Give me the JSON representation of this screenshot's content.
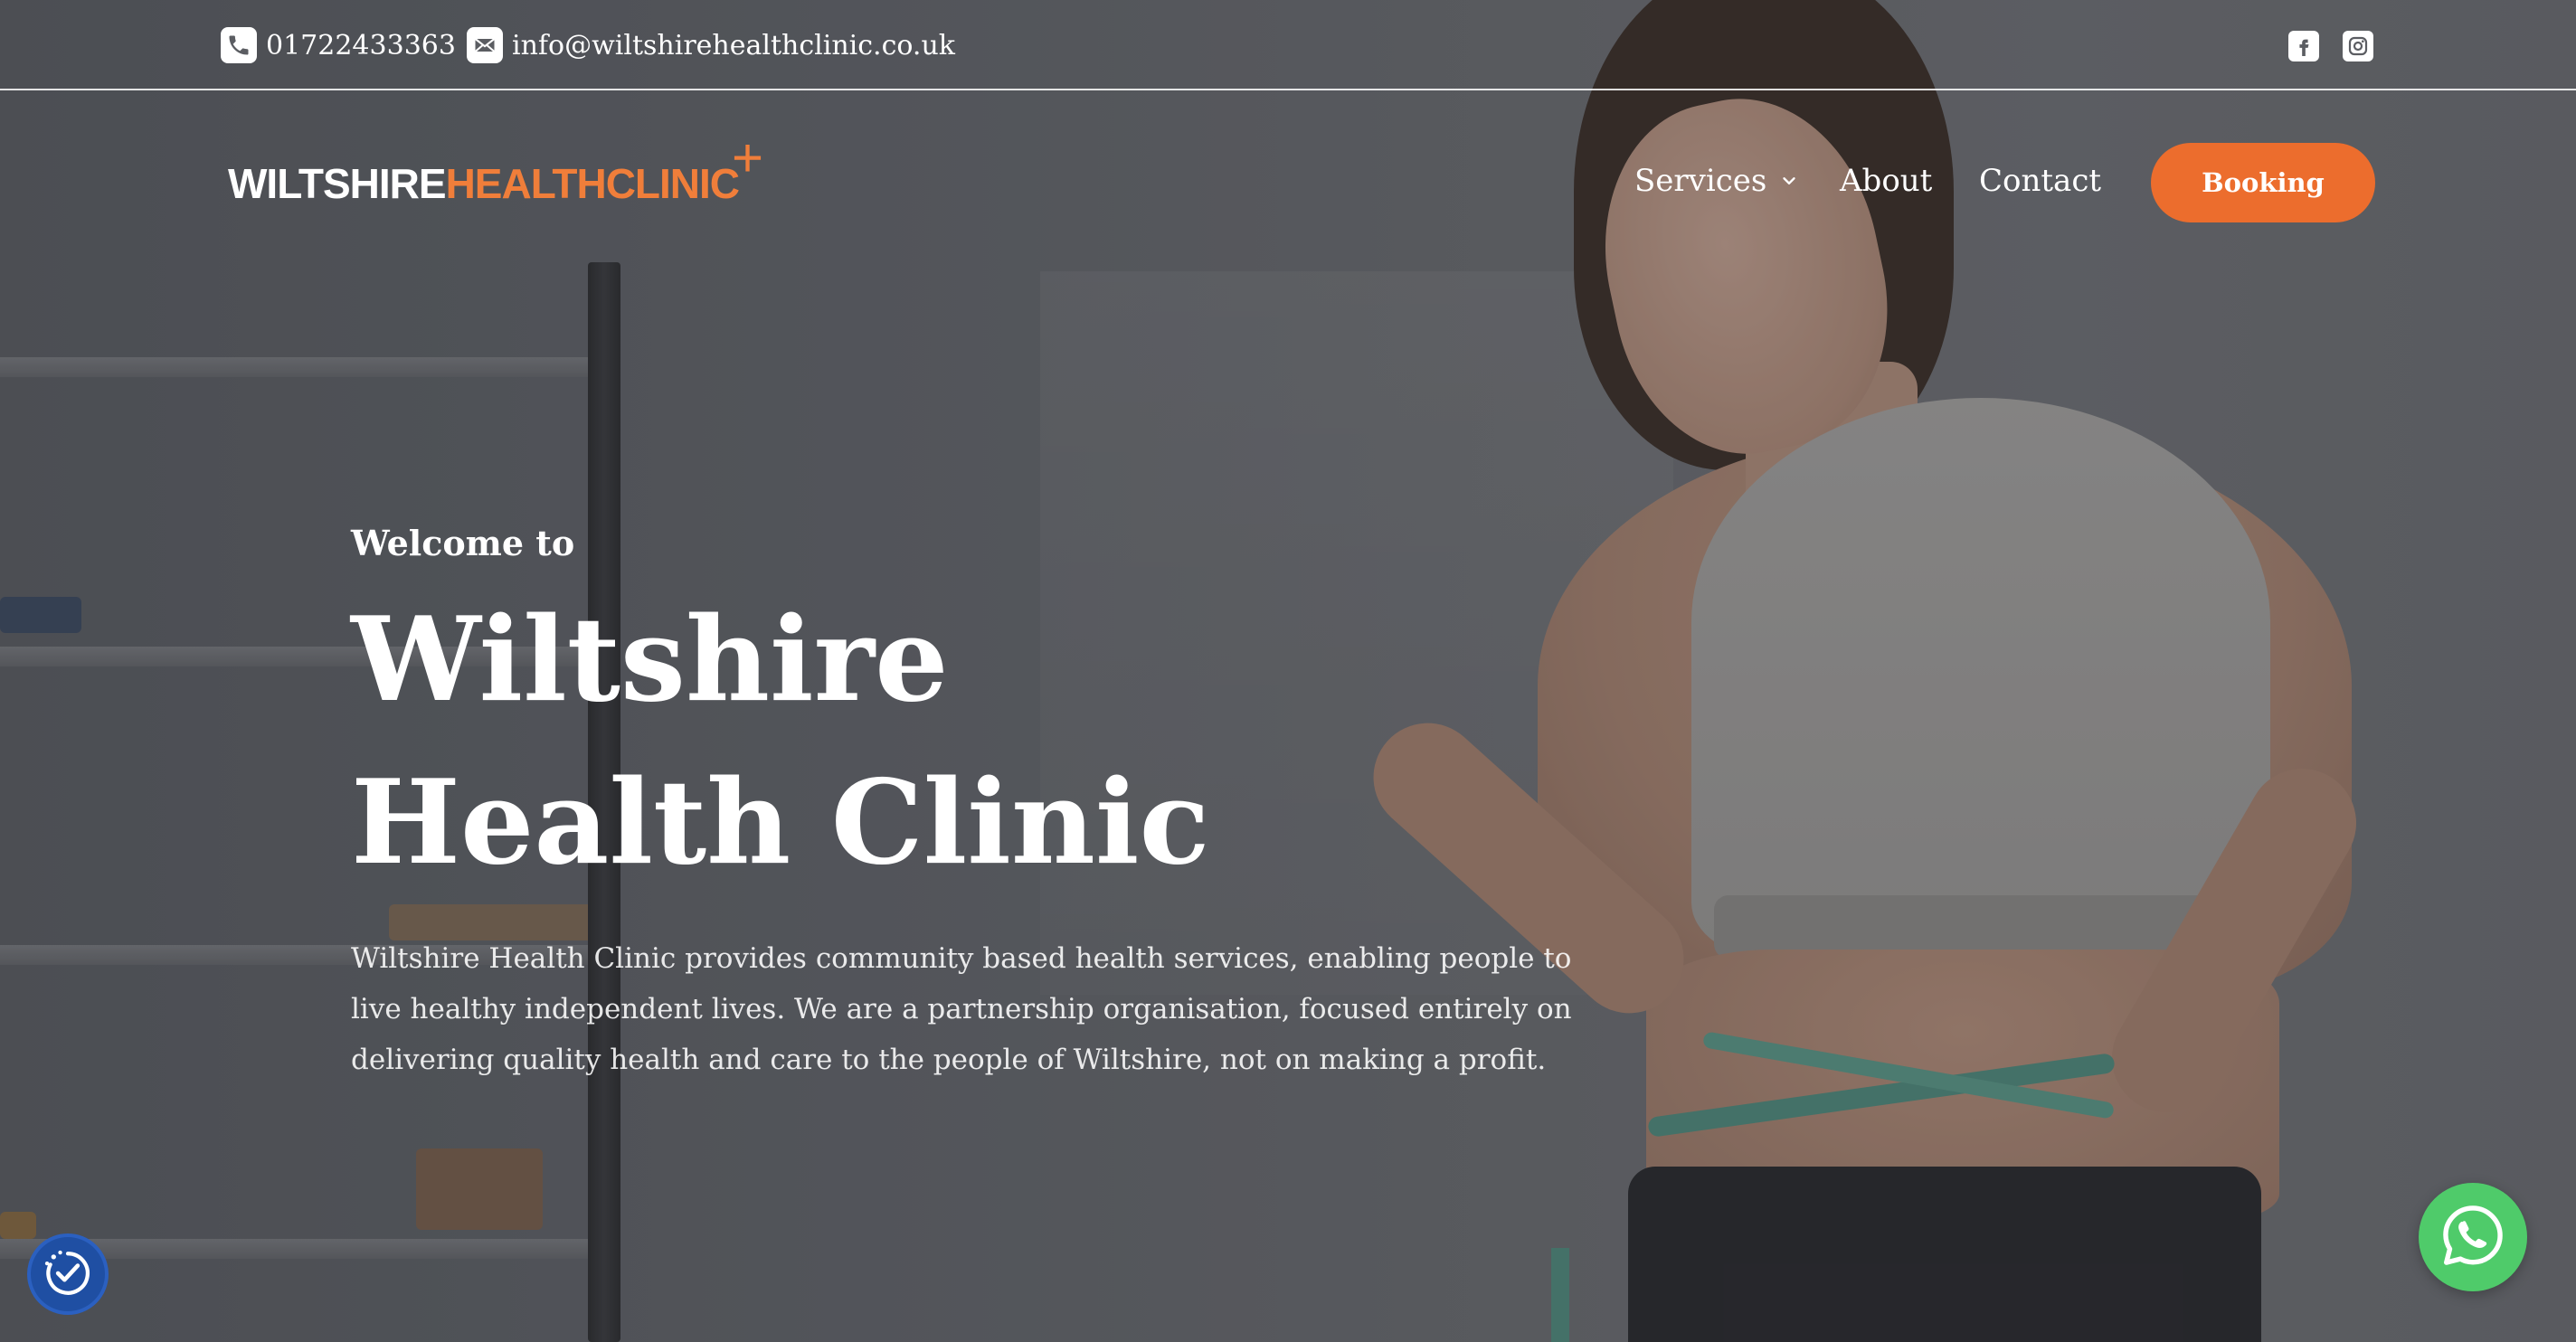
{
  "topbar": {
    "phone": "01722433363",
    "email": "info@wiltshirehealthclinic.co.uk",
    "phone_icon": "phone-icon",
    "email_icon": "email-icon",
    "social": [
      "facebook-icon",
      "instagram-icon"
    ]
  },
  "brand": {
    "logo_part1": "WILTSHIRE",
    "logo_part2": "HEALTHCLINIC",
    "logo_mark": "+",
    "primary_color": "#ec6d2d"
  },
  "nav": {
    "items": [
      {
        "label": "Services",
        "has_dropdown": true
      },
      {
        "label": "About"
      },
      {
        "label": "Contact"
      }
    ],
    "booking_label": "Booking"
  },
  "hero": {
    "kicker": "Welcome to",
    "title_line1": "Wiltshire",
    "title_line2": "Health Clinic",
    "body": "Wiltshire Health Clinic provides community based health services, enabling people to live healthy independent lives. We are a partnership organisation, focused entirely on delivering quality health and care to the people of Wiltshire, not on making a profit."
  },
  "widgets": {
    "accessibility_icon": "accessibility-icon",
    "whatsapp_icon": "whatsapp-icon",
    "whatsapp_color": "#4fcb6a"
  }
}
